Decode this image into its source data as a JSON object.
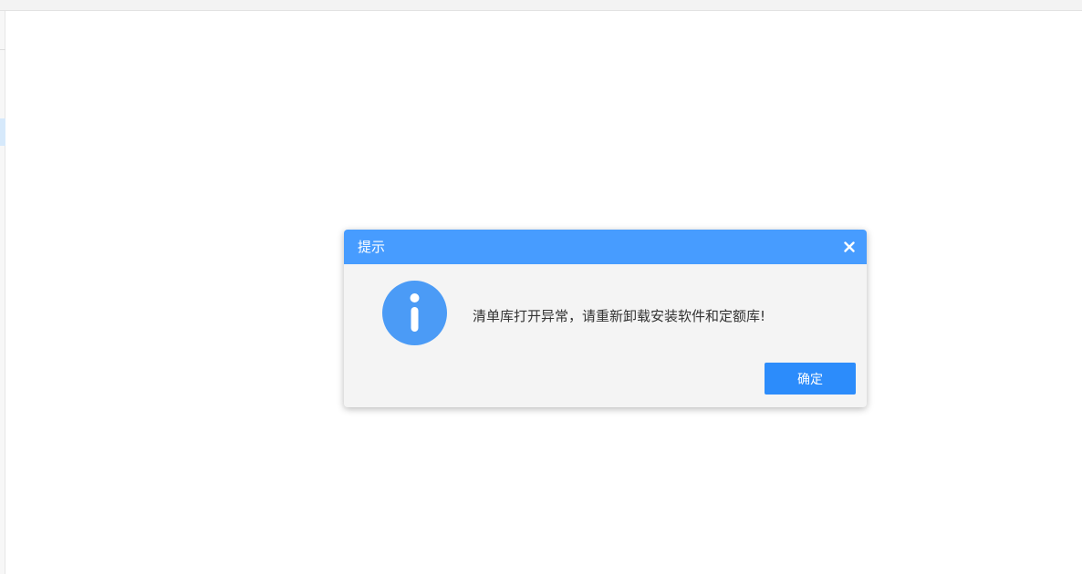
{
  "dialog": {
    "title": "提示",
    "message": "清单库打开异常，请重新卸载安装软件和定额库!",
    "ok_label": "确定",
    "close_icon": "close-icon",
    "info_icon": "info-icon"
  },
  "colors": {
    "header": "#479cff",
    "button": "#2c8cfb",
    "info_icon": "#4b9bf6",
    "dialog_bg": "#f4f4f4"
  }
}
